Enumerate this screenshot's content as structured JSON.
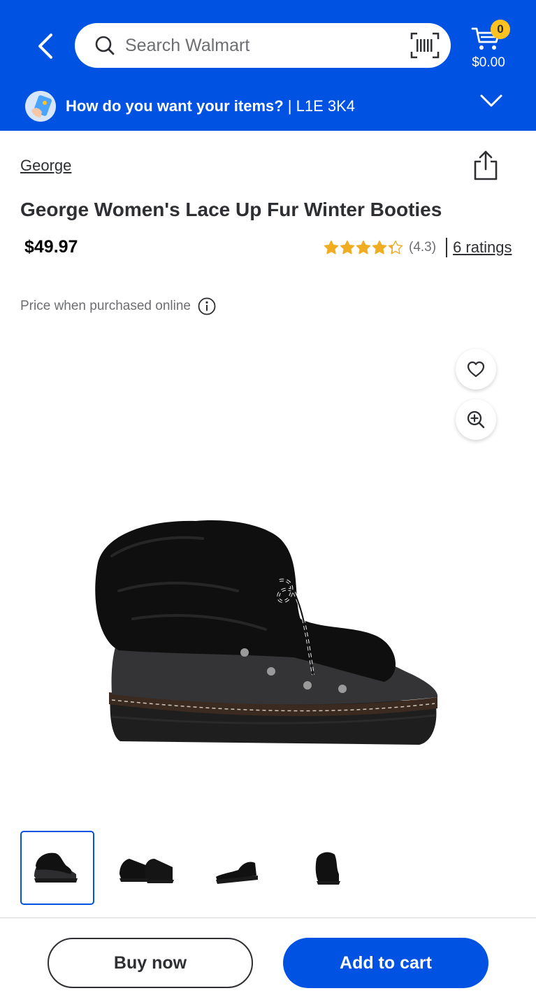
{
  "header": {
    "search_placeholder": "Search Walmart",
    "cart_count": "0",
    "cart_total": "$0.00",
    "delivery_question": "How do you want your items?",
    "delivery_separator": " | ",
    "postal_code": "L1E 3K4",
    "icons": [
      "back-arrow-icon",
      "search-icon",
      "barcode-scanner-icon",
      "cart-icon",
      "delivery-icon",
      "chevron-down-icon"
    ]
  },
  "product": {
    "brand": "George",
    "title": "George Women's Lace Up Fur Winter Booties",
    "price": "$49.97",
    "rating_value": 4.3,
    "rating_text": "(4.3)",
    "ratings_link": "6 ratings",
    "price_note": "Price when purchased online",
    "thumbnail_count": 4,
    "selected_thumbnail": 1
  },
  "actions": {
    "buy_now": "Buy now",
    "add_to_cart": "Add to cart"
  },
  "colors": {
    "brand_blue": "#0053e2",
    "spark_yellow": "#ffc220",
    "star_color": "#f0ad22",
    "text_dark": "#2e2f32",
    "text_muted": "#6d6e71"
  }
}
